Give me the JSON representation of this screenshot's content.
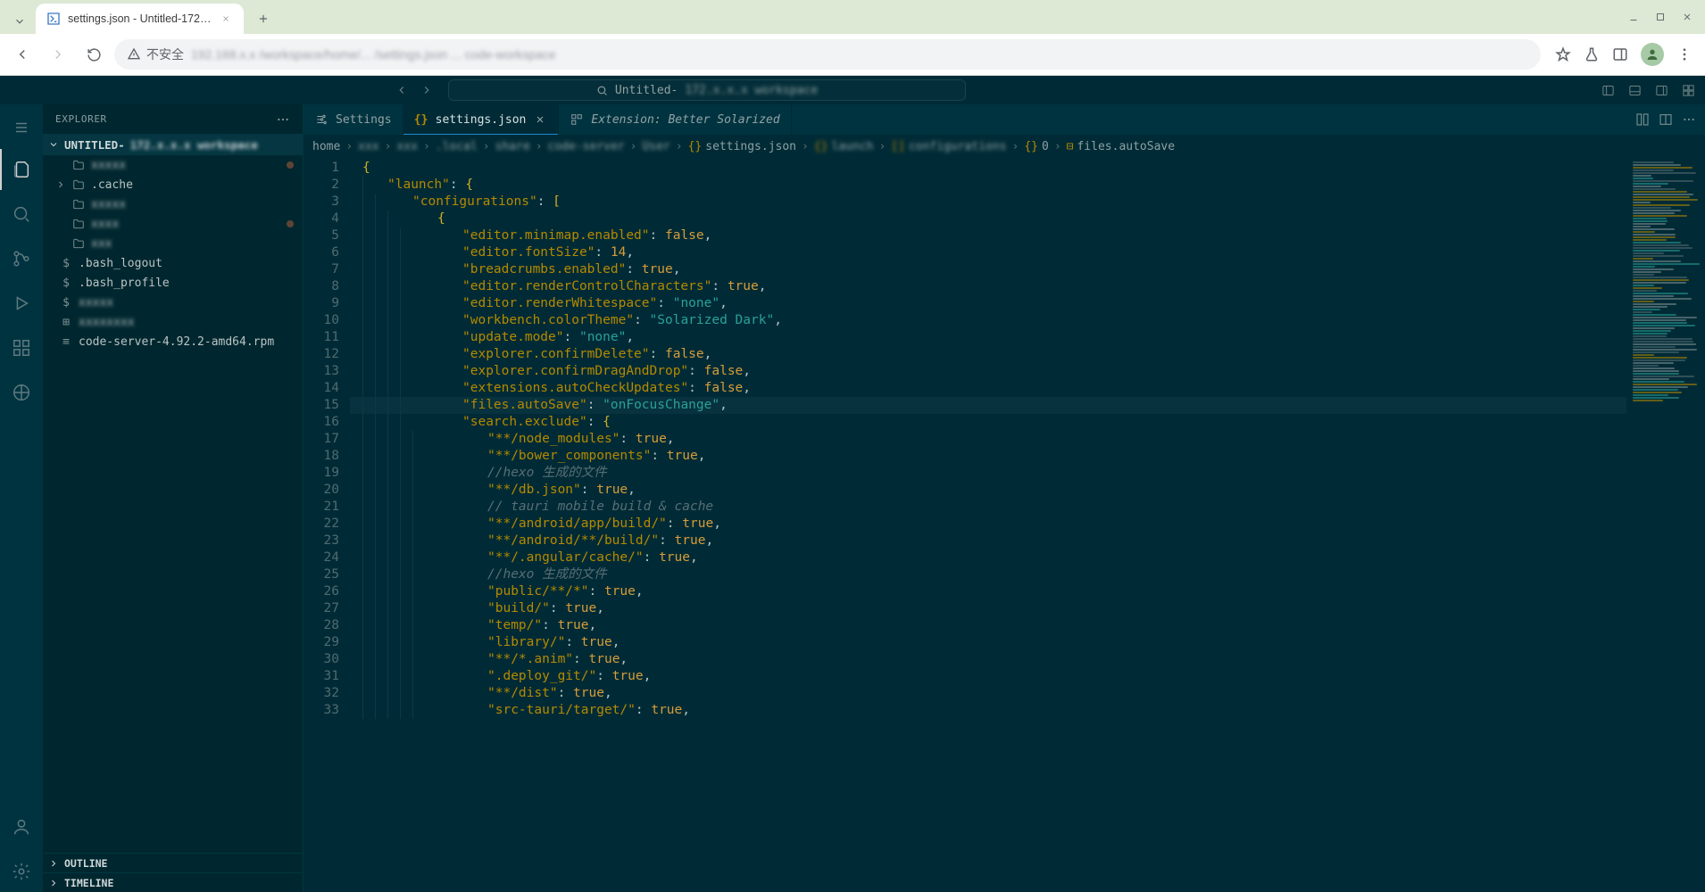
{
  "browser": {
    "tab_title": "settings.json - Untitled-172…",
    "insecure_label": "不安全",
    "url_blurred": "192.168.x.x /workspace/home/... /settings.json ... code-workspace"
  },
  "vscode": {
    "cmd_center_label": "Untitled-",
    "cmd_center_blur": "172.x.x.x  workspace"
  },
  "sidebar": {
    "title": "EXPLORER",
    "root_label_prefix": "UNTITLED-",
    "root_label_blur": "172.x.x.x  workspace",
    "items": [
      {
        "type": "folder",
        "label": "xxxxx",
        "blur": true,
        "dot": true
      },
      {
        "type": "folder",
        "label": ".cache",
        "blur": false,
        "dot": false,
        "chev": true
      },
      {
        "type": "folder",
        "label": "xxxxx",
        "blur": true,
        "dot": false
      },
      {
        "type": "folder",
        "label": "xxxx",
        "blur": true,
        "dot": true
      },
      {
        "type": "folder",
        "label": "xxx",
        "blur": true,
        "dot": false
      },
      {
        "type": "file",
        "label": ".bash_logout",
        "blur": false,
        "icon": "$"
      },
      {
        "type": "file",
        "label": ".bash_profile",
        "blur": false,
        "icon": "$"
      },
      {
        "type": "file",
        "label": "xxxxx",
        "blur": true,
        "icon": "$"
      },
      {
        "type": "file",
        "label": "xxxxxxxx",
        "blur": true,
        "icon": "⊞"
      },
      {
        "type": "file",
        "label": "code-server-4.92.2-amd64.rpm",
        "blur": false,
        "icon": "≡"
      }
    ],
    "outline": "OUTLINE",
    "timeline": "TIMELINE"
  },
  "tabs": [
    {
      "label": "Settings",
      "icon": "sliders",
      "active": false,
      "closeable": false
    },
    {
      "label": "settings.json",
      "icon": "braces",
      "active": true,
      "closeable": true
    },
    {
      "label": "Extension: Better Solarized",
      "icon": "ext",
      "active": false,
      "closeable": false,
      "italic": true
    }
  ],
  "breadcrumbs": {
    "parts": [
      "home",
      "xxx",
      "xxx",
      ".local",
      "share",
      "code-server",
      "User",
      "settings.json",
      "launch",
      "configurations",
      "0",
      "files.autoSave"
    ],
    "blur_idx": [
      1,
      2,
      3,
      4,
      5,
      6,
      8,
      9
    ],
    "icons_at": {
      "7": "{}",
      "8": "{}",
      "9": "[]",
      "10": "{}",
      "11": "⊟"
    }
  },
  "code": {
    "highlight_line": 15,
    "lines": [
      {
        "n": 1,
        "ind": 0,
        "segs": [
          {
            "c": "tok-brace",
            "t": "{"
          }
        ]
      },
      {
        "n": 2,
        "ind": 1,
        "segs": [
          {
            "c": "tok-key",
            "t": "\"launch\""
          },
          {
            "c": "tok-punc",
            "t": ": "
          },
          {
            "c": "tok-brace",
            "t": "{"
          }
        ]
      },
      {
        "n": 3,
        "ind": 2,
        "segs": [
          {
            "c": "tok-key",
            "t": "\"configurations\""
          },
          {
            "c": "tok-punc",
            "t": ": "
          },
          {
            "c": "tok-brace",
            "t": "["
          }
        ]
      },
      {
        "n": 4,
        "ind": 3,
        "segs": [
          {
            "c": "tok-brace",
            "t": "{"
          }
        ]
      },
      {
        "n": 5,
        "ind": 4,
        "segs": [
          {
            "c": "tok-key",
            "t": "\"editor.minimap.enabled\""
          },
          {
            "c": "tok-punc",
            "t": ": "
          },
          {
            "c": "tok-bool",
            "t": "false"
          },
          {
            "c": "tok-punc",
            "t": ","
          }
        ]
      },
      {
        "n": 6,
        "ind": 4,
        "segs": [
          {
            "c": "tok-key",
            "t": "\"editor.fontSize\""
          },
          {
            "c": "tok-punc",
            "t": ": "
          },
          {
            "c": "tok-bool",
            "t": "14"
          },
          {
            "c": "tok-punc",
            "t": ","
          }
        ]
      },
      {
        "n": 7,
        "ind": 4,
        "segs": [
          {
            "c": "tok-key",
            "t": "\"breadcrumbs.enabled\""
          },
          {
            "c": "tok-punc",
            "t": ": "
          },
          {
            "c": "tok-bool",
            "t": "true"
          },
          {
            "c": "tok-punc",
            "t": ","
          }
        ]
      },
      {
        "n": 8,
        "ind": 4,
        "segs": [
          {
            "c": "tok-key",
            "t": "\"editor.renderControlCharacters\""
          },
          {
            "c": "tok-punc",
            "t": ": "
          },
          {
            "c": "tok-bool",
            "t": "true"
          },
          {
            "c": "tok-punc",
            "t": ","
          }
        ]
      },
      {
        "n": 9,
        "ind": 4,
        "segs": [
          {
            "c": "tok-key",
            "t": "\"editor.renderWhitespace\""
          },
          {
            "c": "tok-punc",
            "t": ": "
          },
          {
            "c": "tok-str",
            "t": "\"none\""
          },
          {
            "c": "tok-punc",
            "t": ","
          }
        ]
      },
      {
        "n": 10,
        "ind": 4,
        "segs": [
          {
            "c": "tok-key",
            "t": "\"workbench.colorTheme\""
          },
          {
            "c": "tok-punc",
            "t": ": "
          },
          {
            "c": "tok-str",
            "t": "\"Solarized Dark\""
          },
          {
            "c": "tok-punc",
            "t": ","
          }
        ]
      },
      {
        "n": 11,
        "ind": 4,
        "segs": [
          {
            "c": "tok-key",
            "t": "\"update.mode\""
          },
          {
            "c": "tok-punc",
            "t": ": "
          },
          {
            "c": "tok-str",
            "t": "\"none\""
          },
          {
            "c": "tok-punc",
            "t": ","
          }
        ]
      },
      {
        "n": 12,
        "ind": 4,
        "segs": [
          {
            "c": "tok-key",
            "t": "\"explorer.confirmDelete\""
          },
          {
            "c": "tok-punc",
            "t": ": "
          },
          {
            "c": "tok-bool",
            "t": "false"
          },
          {
            "c": "tok-punc",
            "t": ","
          }
        ]
      },
      {
        "n": 13,
        "ind": 4,
        "segs": [
          {
            "c": "tok-key",
            "t": "\"explorer.confirmDragAndDrop\""
          },
          {
            "c": "tok-punc",
            "t": ": "
          },
          {
            "c": "tok-bool",
            "t": "false"
          },
          {
            "c": "tok-punc",
            "t": ","
          }
        ]
      },
      {
        "n": 14,
        "ind": 4,
        "segs": [
          {
            "c": "tok-key",
            "t": "\"extensions.autoCheckUpdates\""
          },
          {
            "c": "tok-punc",
            "t": ": "
          },
          {
            "c": "tok-bool",
            "t": "false"
          },
          {
            "c": "tok-punc",
            "t": ","
          }
        ]
      },
      {
        "n": 15,
        "ind": 4,
        "segs": [
          {
            "c": "tok-key",
            "t": "\"files.autoSave\""
          },
          {
            "c": "tok-punc",
            "t": ": "
          },
          {
            "c": "tok-str",
            "t": "\"onFocusChange\""
          },
          {
            "c": "tok-punc",
            "t": ","
          }
        ]
      },
      {
        "n": 16,
        "ind": 4,
        "segs": [
          {
            "c": "tok-key",
            "t": "\"search.exclude\""
          },
          {
            "c": "tok-punc",
            "t": ": "
          },
          {
            "c": "tok-brace",
            "t": "{"
          }
        ]
      },
      {
        "n": 17,
        "ind": 5,
        "segs": [
          {
            "c": "tok-key",
            "t": "\"**/node_modules\""
          },
          {
            "c": "tok-punc",
            "t": ": "
          },
          {
            "c": "tok-bool",
            "t": "true"
          },
          {
            "c": "tok-punc",
            "t": ","
          }
        ]
      },
      {
        "n": 18,
        "ind": 5,
        "segs": [
          {
            "c": "tok-key",
            "t": "\"**/bower_components\""
          },
          {
            "c": "tok-punc",
            "t": ": "
          },
          {
            "c": "tok-bool",
            "t": "true"
          },
          {
            "c": "tok-punc",
            "t": ","
          }
        ]
      },
      {
        "n": 19,
        "ind": 5,
        "segs": [
          {
            "c": "tok-comment",
            "t": "//hexo 生成的文件"
          }
        ]
      },
      {
        "n": 20,
        "ind": 5,
        "segs": [
          {
            "c": "tok-key",
            "t": "\"**/db.json\""
          },
          {
            "c": "tok-punc",
            "t": ": "
          },
          {
            "c": "tok-bool",
            "t": "true"
          },
          {
            "c": "tok-punc",
            "t": ","
          }
        ]
      },
      {
        "n": 21,
        "ind": 5,
        "segs": [
          {
            "c": "tok-comment",
            "t": "// tauri mobile build & cache"
          }
        ]
      },
      {
        "n": 22,
        "ind": 5,
        "segs": [
          {
            "c": "tok-key",
            "t": "\"**/android/app/build/\""
          },
          {
            "c": "tok-punc",
            "t": ": "
          },
          {
            "c": "tok-bool",
            "t": "true"
          },
          {
            "c": "tok-punc",
            "t": ","
          }
        ]
      },
      {
        "n": 23,
        "ind": 5,
        "segs": [
          {
            "c": "tok-key",
            "t": "\"**/android/**/build/\""
          },
          {
            "c": "tok-punc",
            "t": ": "
          },
          {
            "c": "tok-bool",
            "t": "true"
          },
          {
            "c": "tok-punc",
            "t": ","
          }
        ]
      },
      {
        "n": 24,
        "ind": 5,
        "segs": [
          {
            "c": "tok-key",
            "t": "\"**/.angular/cache/\""
          },
          {
            "c": "tok-punc",
            "t": ": "
          },
          {
            "c": "tok-bool",
            "t": "true"
          },
          {
            "c": "tok-punc",
            "t": ","
          }
        ]
      },
      {
        "n": 25,
        "ind": 5,
        "segs": [
          {
            "c": "tok-comment",
            "t": "//hexo 生成的文件"
          }
        ]
      },
      {
        "n": 26,
        "ind": 5,
        "segs": [
          {
            "c": "tok-key",
            "t": "\"public/**/*\""
          },
          {
            "c": "tok-punc",
            "t": ": "
          },
          {
            "c": "tok-bool",
            "t": "true"
          },
          {
            "c": "tok-punc",
            "t": ","
          }
        ]
      },
      {
        "n": 27,
        "ind": 5,
        "segs": [
          {
            "c": "tok-key",
            "t": "\"build/\""
          },
          {
            "c": "tok-punc",
            "t": ": "
          },
          {
            "c": "tok-bool",
            "t": "true"
          },
          {
            "c": "tok-punc",
            "t": ","
          }
        ]
      },
      {
        "n": 28,
        "ind": 5,
        "segs": [
          {
            "c": "tok-key",
            "t": "\"temp/\""
          },
          {
            "c": "tok-punc",
            "t": ": "
          },
          {
            "c": "tok-bool",
            "t": "true"
          },
          {
            "c": "tok-punc",
            "t": ","
          }
        ]
      },
      {
        "n": 29,
        "ind": 5,
        "segs": [
          {
            "c": "tok-key",
            "t": "\"library/\""
          },
          {
            "c": "tok-punc",
            "t": ": "
          },
          {
            "c": "tok-bool",
            "t": "true"
          },
          {
            "c": "tok-punc",
            "t": ","
          }
        ]
      },
      {
        "n": 30,
        "ind": 5,
        "segs": [
          {
            "c": "tok-key",
            "t": "\"**/*.anim\""
          },
          {
            "c": "tok-punc",
            "t": ": "
          },
          {
            "c": "tok-bool",
            "t": "true"
          },
          {
            "c": "tok-punc",
            "t": ","
          }
        ]
      },
      {
        "n": 31,
        "ind": 5,
        "segs": [
          {
            "c": "tok-key",
            "t": "\".deploy_git/\""
          },
          {
            "c": "tok-punc",
            "t": ": "
          },
          {
            "c": "tok-bool",
            "t": "true"
          },
          {
            "c": "tok-punc",
            "t": ","
          }
        ]
      },
      {
        "n": 32,
        "ind": 5,
        "segs": [
          {
            "c": "tok-key",
            "t": "\"**/dist\""
          },
          {
            "c": "tok-punc",
            "t": ": "
          },
          {
            "c": "tok-bool",
            "t": "true"
          },
          {
            "c": "tok-punc",
            "t": ","
          }
        ]
      },
      {
        "n": 33,
        "ind": 5,
        "segs": [
          {
            "c": "tok-key",
            "t": "\"src-tauri/target/\""
          },
          {
            "c": "tok-punc",
            "t": ": "
          },
          {
            "c": "tok-bool",
            "t": "true"
          },
          {
            "c": "tok-punc",
            "t": ","
          }
        ]
      }
    ]
  }
}
